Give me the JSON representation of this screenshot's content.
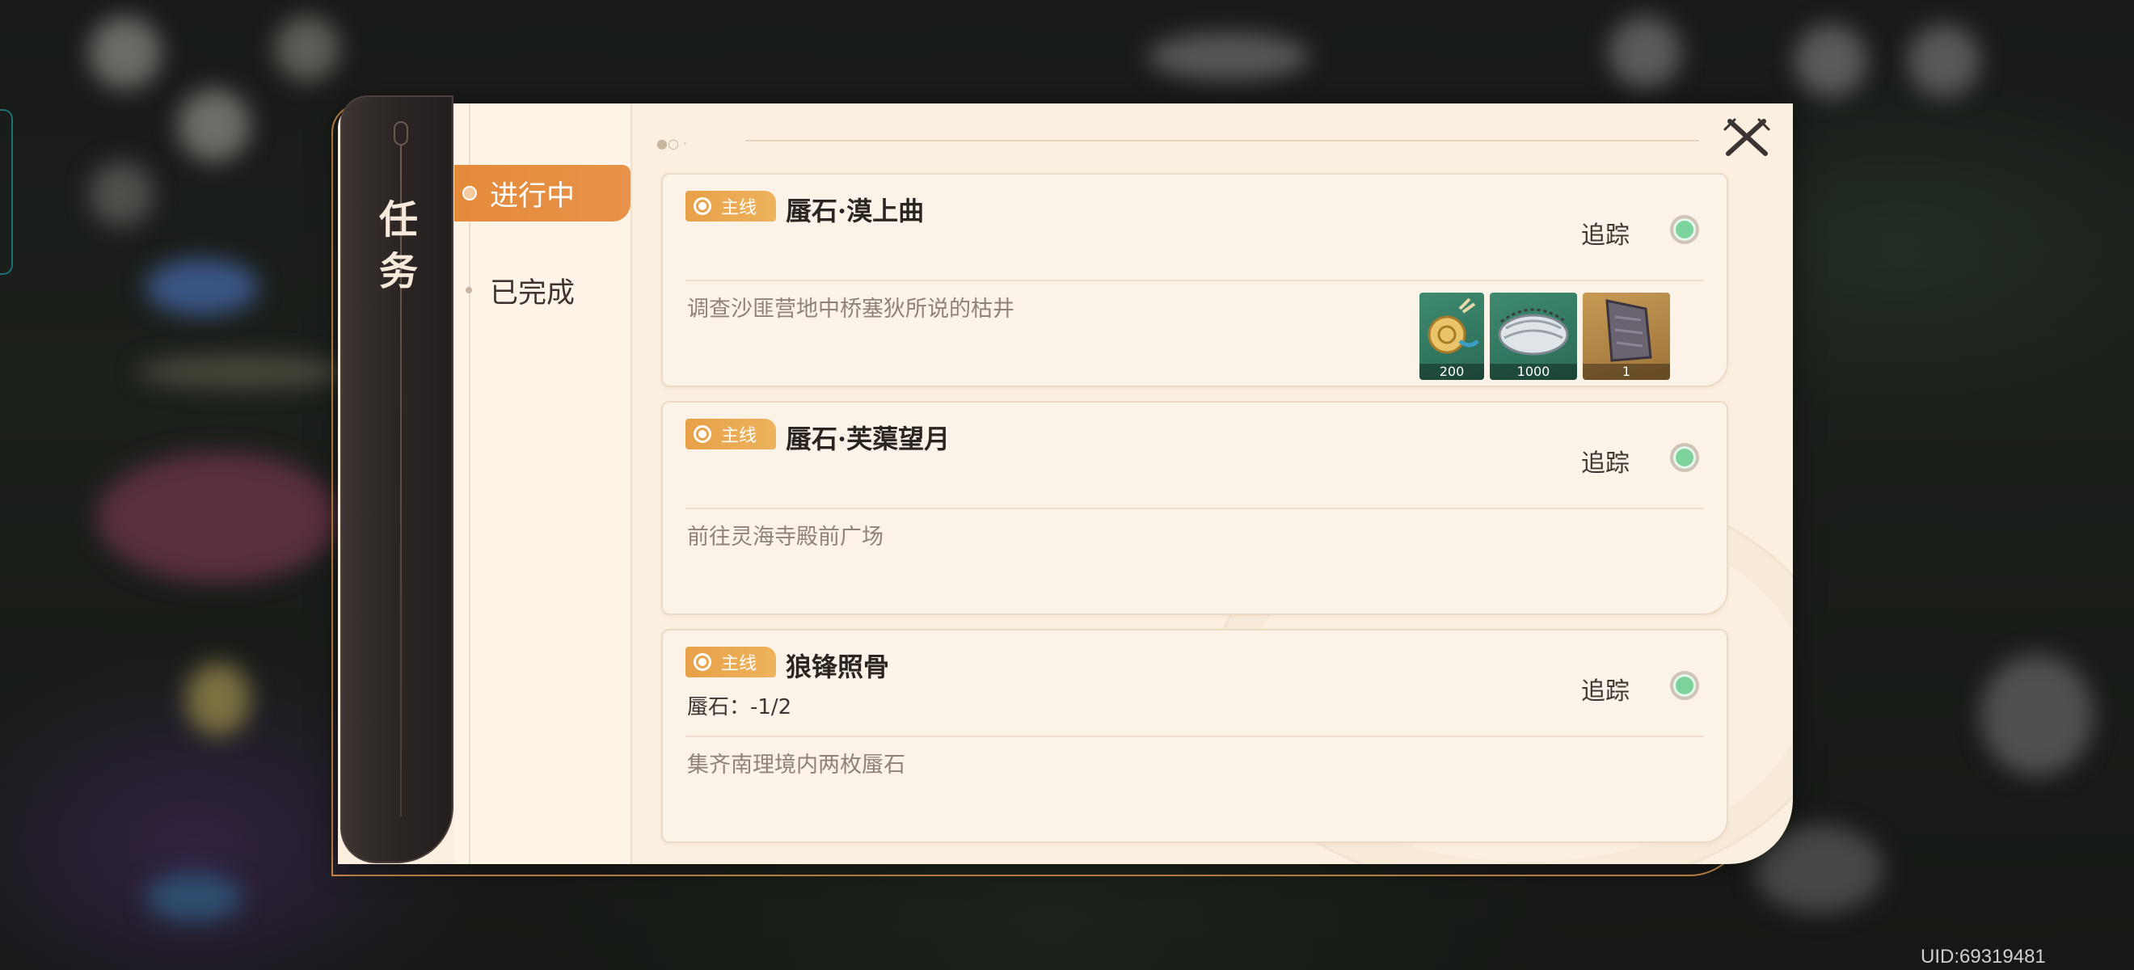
{
  "panel": {
    "title": "任务"
  },
  "tabs": [
    {
      "label": "进行中",
      "active": true
    },
    {
      "label": "已完成",
      "active": false
    }
  ],
  "quests": [
    {
      "tag": "主线",
      "title": "蜃石·漠上曲",
      "track_label": "追踪",
      "progress": "",
      "description": "调查沙匪营地中桥塞狄所说的枯井",
      "rewards": [
        {
          "icon": "coin-bundle-icon",
          "count": "200"
        },
        {
          "icon": "silver-roll-icon",
          "count": "1000"
        },
        {
          "icon": "stone-tablet-icon",
          "count": "1"
        }
      ]
    },
    {
      "tag": "主线",
      "title": "蜃石·芙蕖望月",
      "track_label": "追踪",
      "progress": "",
      "description": "前往灵海寺殿前广场",
      "rewards": []
    },
    {
      "tag": "主线",
      "title": "狼锋照骨",
      "track_label": "追踪",
      "progress": "蜃石：-1/2",
      "description": "集齐南理境内两枚蜃石",
      "rewards": []
    }
  ],
  "uid": "UID:69319481",
  "colors": {
    "accent": "#e48a3a",
    "tag": "#e7a047",
    "track_dot": "#7dd39c",
    "panel_bg": "#fbefe0"
  }
}
